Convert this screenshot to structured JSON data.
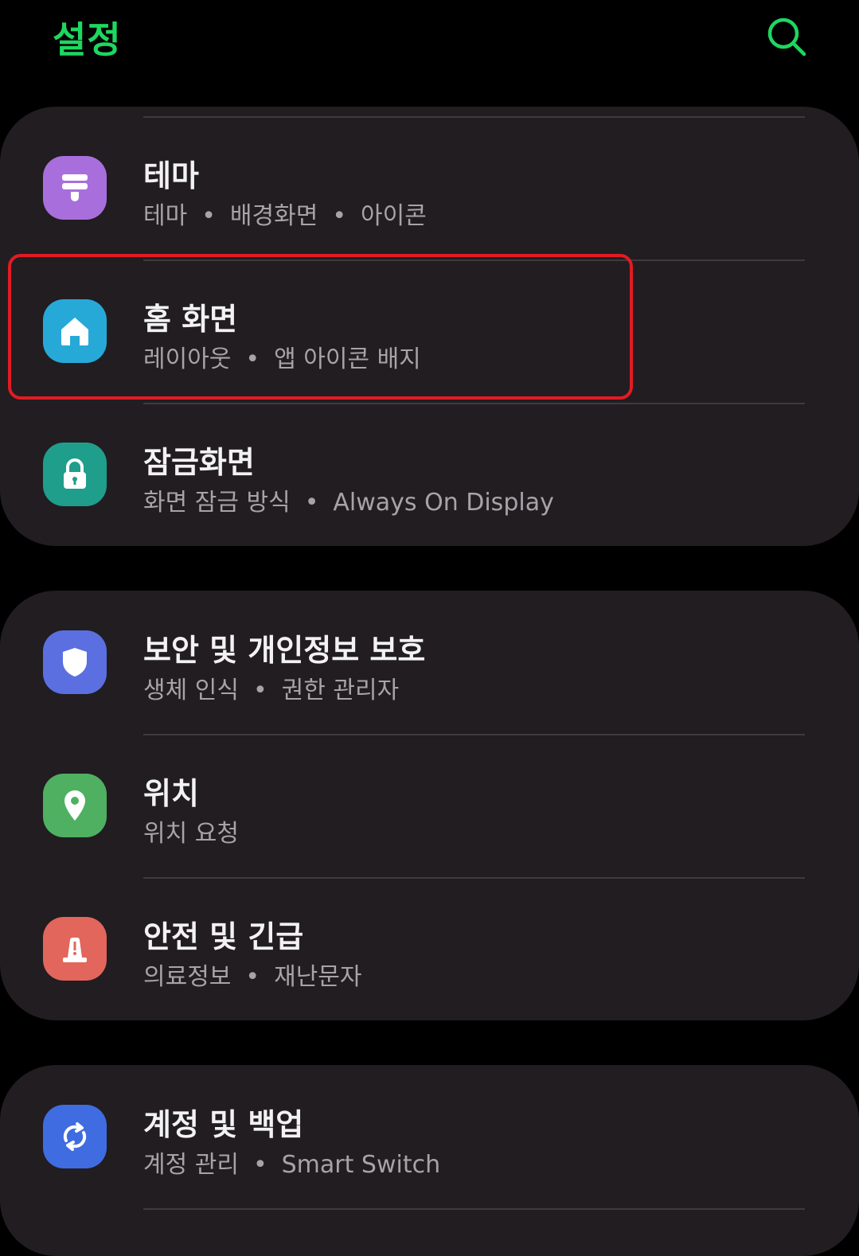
{
  "header": {
    "title": "설정",
    "title_color": "#1ed760",
    "search_icon": "search-icon"
  },
  "colors": {
    "background": "#000000",
    "card": "#211d21",
    "divider": "#3e3a3e",
    "highlight": "#e21b22"
  },
  "cards": [
    {
      "items": [
        {
          "title": "테마",
          "subtitle": [
            "테마",
            "배경화면",
            "아이콘"
          ],
          "icon": "brush-icon",
          "icon_color": "#a86fdc"
        },
        {
          "title": "홈 화면",
          "subtitle": [
            "레이아웃",
            "앱 아이콘 배지"
          ],
          "icon": "home-icon",
          "icon_color": "#27a9d8"
        },
        {
          "title": "잠금화면",
          "subtitle": [
            "화면 잠금 방식",
            "Always On Display"
          ],
          "icon": "lock-icon",
          "icon_color": "#1f9e8c"
        }
      ]
    },
    {
      "items": [
        {
          "title": "보안 및 개인정보 보호",
          "subtitle": [
            "생체 인식",
            "권한 관리자"
          ],
          "icon": "shield-icon",
          "icon_color": "#5b6fe0"
        },
        {
          "title": "위치",
          "subtitle": [
            "위치 요청"
          ],
          "icon": "location-pin-icon",
          "icon_color": "#4fb062"
        },
        {
          "title": "안전 및 긴급",
          "subtitle": [
            "의료정보",
            "재난문자"
          ],
          "icon": "alert-icon",
          "icon_color": "#e2665b"
        }
      ]
    },
    {
      "items": [
        {
          "title": "계정 및 백업",
          "subtitle": [
            "계정 관리",
            "Smart Switch"
          ],
          "icon": "sync-icon",
          "icon_color": "#3f6ce0"
        }
      ]
    }
  ]
}
